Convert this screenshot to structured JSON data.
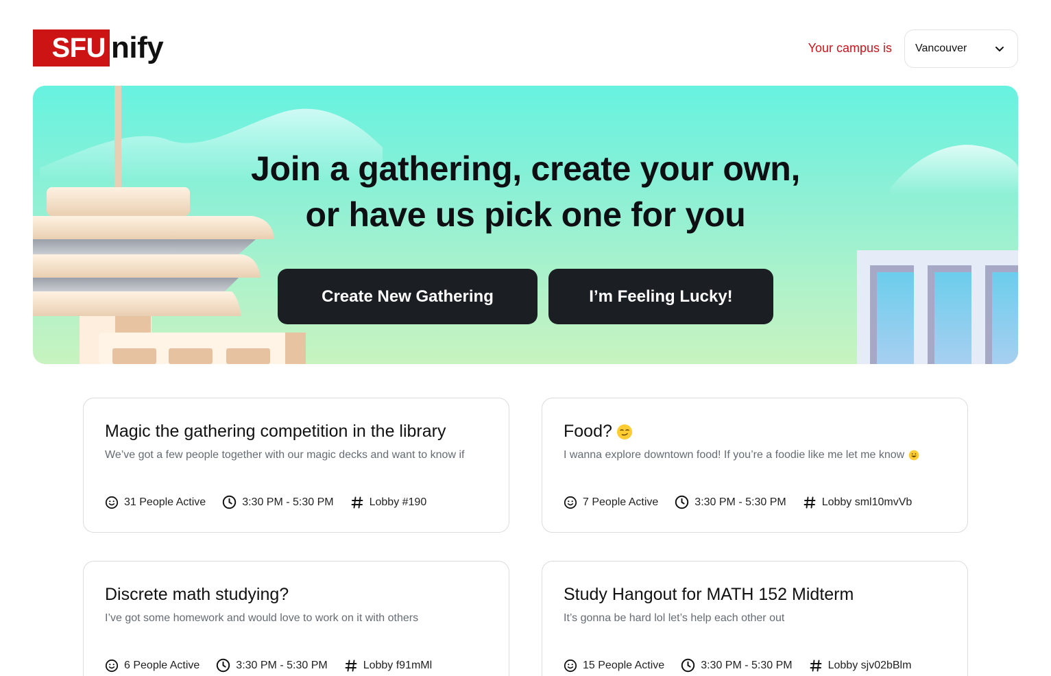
{
  "header": {
    "logo_highlight": "SFU",
    "logo_rest": "nify",
    "campus_label": "Your campus is",
    "campus_value": "Vancouver",
    "brand_color": "#cc1414"
  },
  "hero": {
    "title_line1": "Join a gathering, create your own,",
    "title_line2": "or have us pick one for you",
    "create_button": "Create New Gathering",
    "lucky_button": "I’m Feeling Lucky!"
  },
  "gatherings": [
    {
      "title": "Magic the gathering competition in the library",
      "title_emoji": "",
      "description": "We’ve got a few people together with our magic decks and want to know if",
      "description_emoji": "",
      "active": "31 People Active",
      "time": "3:30 PM - 5:30 PM",
      "lobby": "Lobby #190"
    },
    {
      "title": "Food?",
      "title_emoji": "smirk-emoji",
      "description": "I wanna explore downtown food! If you’re a foodie like me let me know",
      "description_emoji": "grin-emoji",
      "active": "7 People Active",
      "time": "3:30 PM - 5:30 PM",
      "lobby": "Lobby sml10mvVb"
    },
    {
      "title": "Discrete math studying?",
      "title_emoji": "",
      "description": "I’ve got some homework and would love to work on it with others",
      "description_emoji": "",
      "active": "6 People Active",
      "time": "3:30 PM - 5:30 PM",
      "lobby": "Lobby f91mMl"
    },
    {
      "title": "Study Hangout for MATH 152 Midterm",
      "title_emoji": "",
      "description": "It’s gonna be hard lol let’s help each other out",
      "description_emoji": "",
      "active": "15 People Active",
      "time": "3:30 PM - 5:30 PM",
      "lobby": "Lobby sjv02bBlm"
    }
  ]
}
